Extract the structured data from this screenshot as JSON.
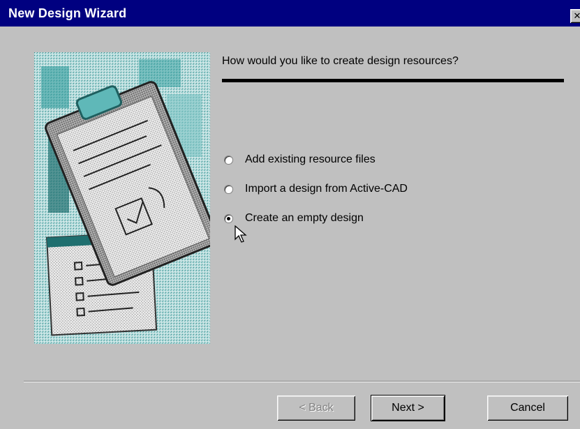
{
  "window": {
    "title": "New Design Wizard",
    "close_glyph": "✕"
  },
  "prompt": {
    "question": "How would you like to create design resources?"
  },
  "options": [
    {
      "label": "Add existing resource files",
      "selected": false
    },
    {
      "label": "Import a design from Active-CAD",
      "selected": false
    },
    {
      "label": "Create an empty design",
      "selected": true
    }
  ],
  "buttons": {
    "back": "< Back",
    "next": "Next >",
    "cancel": "Cancel"
  },
  "colors": {
    "titlebar": "#000080",
    "face": "#c0c0c0",
    "illustration_teal": "#2e9b9b"
  },
  "icons": {
    "cursor": "arrow-pointer-icon",
    "illustration": "clipboard-checklist-icon"
  }
}
